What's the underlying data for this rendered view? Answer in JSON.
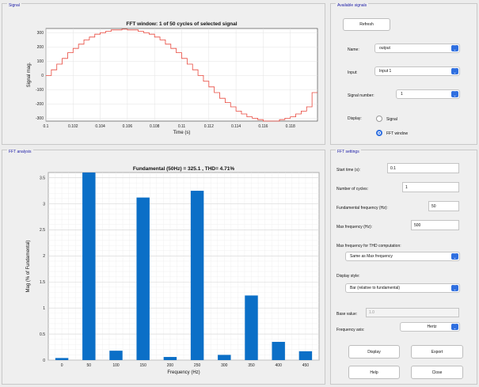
{
  "panels": {
    "signal": "Signal",
    "available": "Available signals",
    "fft_analysis": "FFT analysis",
    "fft_settings": "FFT settings"
  },
  "available_signals": {
    "refresh_label": "Refresh",
    "name_label": "Name:",
    "name_value": "output",
    "input_label": "Input:",
    "input_value": "Input 1",
    "signal_number_label": "Signal number:",
    "signal_number_value": "1",
    "display_label": "Display:",
    "display_options": [
      "Signal",
      "FFT window"
    ],
    "display_selected": "FFT window"
  },
  "fft_settings": {
    "start_time_label": "Start time (s):",
    "start_time_value": "0.1",
    "cycles_label": "Number of cycles:",
    "cycles_value": "1",
    "fund_freq_label": "Fundamental frequency (Hz):",
    "fund_freq_value": "50",
    "max_freq_label": "Max frequency (Hz):",
    "max_freq_value": "500",
    "max_thd_label": "Max frequency for THD computation:",
    "max_thd_value": "Same as Max frequency",
    "display_style_label": "Display style:",
    "display_style_value": "Bar (relative to fundamental)",
    "base_value_label": "Base value:",
    "base_value_value": "1.0",
    "freq_axis_label": "Frequency axis:",
    "freq_axis_value": "Hertz",
    "display_button": "Display",
    "export_button": "Export",
    "help_button": "Help",
    "close_button": "Close"
  },
  "icons": {
    "dropdown": "chevron-updown-icon"
  },
  "colors": {
    "accent": "#2f6fe0",
    "signal_line": "#e8473c",
    "bar": "#0b6fc7"
  },
  "chart_data": [
    {
      "type": "line",
      "title": "FFT window: 1 of 50 cycles of selected signal",
      "xlabel": "Time (s)",
      "ylabel": "Signal mag.",
      "xlim": [
        0.1,
        0.12
      ],
      "ylim": [
        -320,
        330
      ],
      "xticks": [
        "0.1",
        "0.102",
        "0.104",
        "0.106",
        "0.108",
        "0.11",
        "0.112",
        "0.114",
        "0.116",
        "0.118"
      ],
      "yticks": [
        "300",
        "200",
        "100",
        "0",
        "-100",
        "-200",
        "-300"
      ],
      "grid": true,
      "x": [
        0.1,
        0.1004,
        0.1008,
        0.1012,
        0.1016,
        0.102,
        0.1024,
        0.1028,
        0.1032,
        0.1036,
        0.104,
        0.1044,
        0.1048,
        0.1052,
        0.1056,
        0.106,
        0.1064,
        0.1068,
        0.1072,
        0.1076,
        0.108,
        0.1084,
        0.1088,
        0.1092,
        0.1096,
        0.11,
        0.1104,
        0.1108,
        0.1112,
        0.1116,
        0.112,
        0.1124,
        0.1128,
        0.1132,
        0.1136,
        0.114,
        0.1144,
        0.1148,
        0.1152,
        0.1156,
        0.116,
        0.1164,
        0.1168,
        0.1172,
        0.1176,
        0.118,
        0.1184,
        0.1188,
        0.1192,
        0.1196
      ],
      "values": [
        0,
        40,
        80,
        120,
        160,
        190,
        220,
        250,
        270,
        290,
        300,
        310,
        320,
        320,
        325,
        320,
        320,
        310,
        300,
        290,
        270,
        250,
        220,
        190,
        160,
        120,
        80,
        40,
        0,
        -40,
        -80,
        -120,
        -160,
        -190,
        -220,
        -250,
        -270,
        -290,
        -300,
        -310,
        -320,
        -320,
        -320,
        -310,
        -300,
        -290,
        -270,
        -250,
        -220,
        -120
      ]
    },
    {
      "type": "bar",
      "title": "Fundamental (50Hz) = 325.1 , THD= 4.71%",
      "xlabel": "Frequency (Hz)",
      "ylabel": "Mag (% of Fundamental)",
      "categories": [
        "0",
        "50",
        "100",
        "150",
        "200",
        "250",
        "300",
        "350",
        "400",
        "450"
      ],
      "values": [
        0.04,
        3.6,
        0.18,
        3.12,
        0.06,
        3.25,
        0.1,
        1.24,
        0.35,
        0.17
      ],
      "yticks": [
        "3.5",
        "3",
        "2.5",
        "2",
        "1.5",
        "1",
        "0.5",
        "0"
      ],
      "ylim": [
        0,
        3.6
      ],
      "grid": true
    }
  ]
}
